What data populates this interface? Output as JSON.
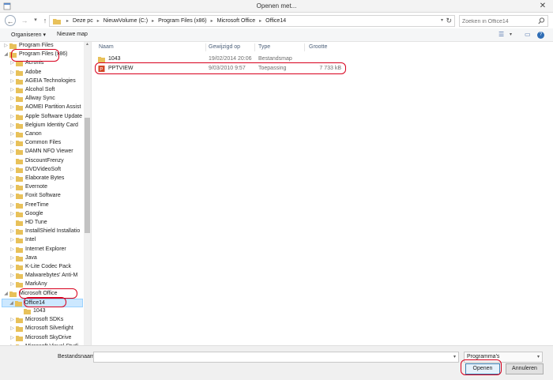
{
  "window": {
    "title": "Openen met..."
  },
  "address": {
    "crumbs": [
      "Deze pc",
      "NieuwVolume (C:)",
      "Program Files (x86)",
      "Microsoft Office",
      "Office14"
    ],
    "search_placeholder": "Zoeken in Office14"
  },
  "toolbar": {
    "organize": "Organiseren ▾",
    "new_folder": "Nieuwe map"
  },
  "nav": {
    "items": [
      {
        "label": "Program Files",
        "arrow": "▷"
      },
      {
        "label": "Program Files (x86)",
        "arrow": "◢"
      },
      {
        "label": "Acronis",
        "arrow": "▷"
      },
      {
        "label": "Adobe",
        "arrow": "▷"
      },
      {
        "label": "AGEIA Technologies",
        "arrow": "▷"
      },
      {
        "label": "Alcohol Soft",
        "arrow": "▷"
      },
      {
        "label": "Allway Sync",
        "arrow": "▷"
      },
      {
        "label": "AOMEI Partition Assist",
        "arrow": "▷"
      },
      {
        "label": "Apple Software Update",
        "arrow": "▷"
      },
      {
        "label": "Belgium Identity Card",
        "arrow": "▷"
      },
      {
        "label": "Canon",
        "arrow": "▷"
      },
      {
        "label": "Common Files",
        "arrow": "▷"
      },
      {
        "label": "DAMN NFO Viewer",
        "arrow": "▷"
      },
      {
        "label": "DiscountFrenzy",
        "arrow": ""
      },
      {
        "label": "DVDVideoSoft",
        "arrow": "▷"
      },
      {
        "label": "Elaborate Bytes",
        "arrow": "▷"
      },
      {
        "label": "Evernote",
        "arrow": "▷"
      },
      {
        "label": "Foxit Software",
        "arrow": "▷"
      },
      {
        "label": "FreeTime",
        "arrow": "▷"
      },
      {
        "label": "Google",
        "arrow": "▷"
      },
      {
        "label": "HD Tune",
        "arrow": ""
      },
      {
        "label": "InstallShield Installatio",
        "arrow": "▷"
      },
      {
        "label": "Intel",
        "arrow": "▷"
      },
      {
        "label": "Internet Explorer",
        "arrow": "▷"
      },
      {
        "label": "Java",
        "arrow": "▷"
      },
      {
        "label": "K-Lite Codec Pack",
        "arrow": "▷"
      },
      {
        "label": "Malwarebytes' Anti-M",
        "arrow": "▷"
      },
      {
        "label": "MarkAny",
        "arrow": "▷"
      },
      {
        "label": "Microsoft Office",
        "arrow": "◢"
      },
      {
        "label": "Office14",
        "arrow": "◢"
      },
      {
        "label": "1043",
        "arrow": ""
      },
      {
        "label": "Microsoft SDKs",
        "arrow": "▷"
      },
      {
        "label": "Microsoft Silverlight",
        "arrow": "▷"
      },
      {
        "label": "Microsoft SkyDrive",
        "arrow": "▷"
      },
      {
        "label": "Microsoft Visual Studi",
        "arrow": "▷"
      }
    ]
  },
  "files": {
    "columns": [
      "Naam",
      "Gewijzigd op",
      "Type",
      "Grootte"
    ],
    "rows": [
      {
        "name": "1043",
        "modified": "19/02/2014 20:06",
        "type": "Bestandsmap",
        "size": "",
        "icon": "folder-icon"
      },
      {
        "name": "PPTVIEW",
        "modified": "9/03/2010 9:57",
        "type": "Toepassing",
        "size": "7 733 kB",
        "icon": "pptview-app-icon"
      }
    ]
  },
  "bottom": {
    "filename_label": "Bestandsnaam:",
    "filename_value": "",
    "filetype": "Programma's",
    "open_label": "Openen",
    "cancel_label": "Annuleren"
  },
  "colors": {
    "annotation": "#d8001d",
    "folder": "#e8c15a",
    "selection": "#cce8ff"
  }
}
